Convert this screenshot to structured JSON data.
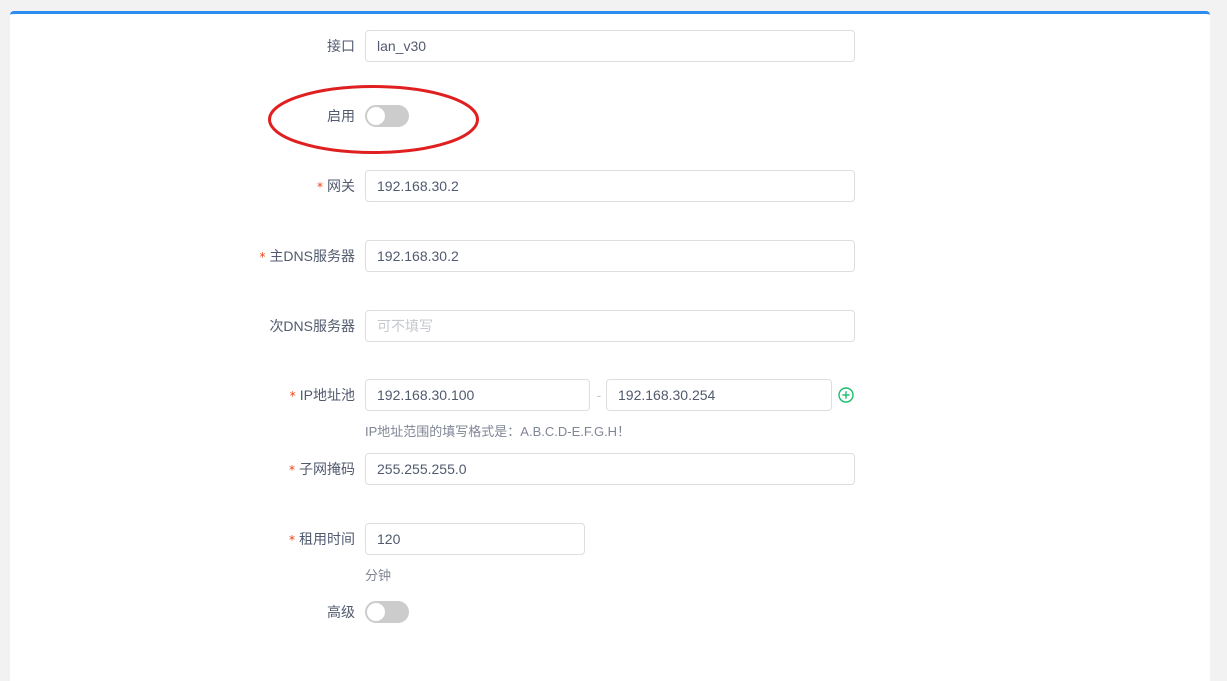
{
  "form": {
    "interface": {
      "label": "接口",
      "value": "lan_v30"
    },
    "enable": {
      "label": "启用",
      "on": false
    },
    "gateway": {
      "required_mark": "*",
      "label": "网关",
      "value": "192.168.30.2"
    },
    "primary_dns": {
      "required_mark": "*",
      "label": "主DNS服务器",
      "value": "192.168.30.2"
    },
    "secondary_dns": {
      "label": "次DNS服务器",
      "value": "",
      "placeholder": "可不填写"
    },
    "ip_pool": {
      "required_mark": "*",
      "label": "IP地址池",
      "start": "192.168.30.100",
      "separator": "-",
      "end": "192.168.30.254",
      "hint": "IP地址范围的填写格式是：A.B.C.D-E.F.G.H！"
    },
    "subnet_mask": {
      "required_mark": "*",
      "label": "子网掩码",
      "value": "255.255.255.0"
    },
    "lease_time": {
      "required_mark": "*",
      "label": "租用时间",
      "value": "120",
      "unit": "分钟"
    },
    "advanced": {
      "label": "高级",
      "on": false
    }
  },
  "colors": {
    "accent": "#2d8cf0",
    "required": "#ed4014",
    "add_icon": "#19be6b",
    "annotation": "#e02020"
  },
  "icons": {
    "add": "plus-circle-icon"
  }
}
